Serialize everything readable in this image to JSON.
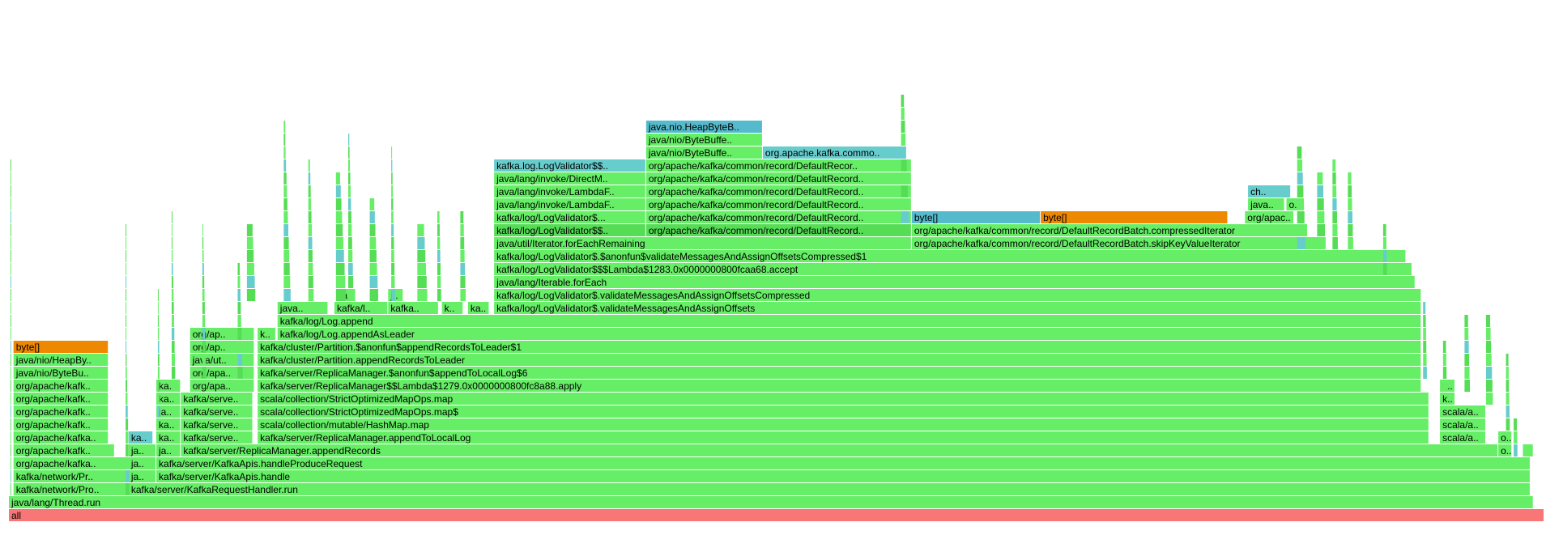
{
  "chart_data": {
    "type": "flamegraph",
    "frame_colors": {
      "root": "#f87676",
      "java": "#66ee66",
      "inlined": "#55dd55",
      "native": "#66cccc",
      "alloc": "#ee8800",
      "alloc_type": "#55bbcc"
    },
    "frames": [
      {
        "label": "all",
        "depth": 0,
        "start": 0,
        "width": 1000,
        "kind": "root"
      },
      {
        "label": "java/lang/Thread.run",
        "depth": 1,
        "start": 0,
        "width": 993,
        "kind": "java"
      },
      {
        "label": "kafka/network/Pro..",
        "depth": 2,
        "start": 3,
        "width": 74,
        "kind": "java"
      },
      {
        "label": "kafka/server/KafkaRequestHandler.run",
        "depth": 2,
        "start": 78,
        "width": 913,
        "kind": "java"
      },
      {
        "label": "kafka/network/Pr..",
        "depth": 3,
        "start": 3,
        "width": 74,
        "kind": "java"
      },
      {
        "label": "ja..",
        "depth": 3,
        "start": 78,
        "width": 18,
        "kind": "java"
      },
      {
        "label": "kafka/server/KafkaApis.handle",
        "depth": 3,
        "start": 96,
        "width": 895,
        "kind": "java"
      },
      {
        "label": "org/apache/kafka..",
        "depth": 4,
        "start": 3,
        "width": 74,
        "kind": "java"
      },
      {
        "label": "ja..",
        "depth": 4,
        "start": 78,
        "width": 18,
        "kind": "java"
      },
      {
        "label": "kafka/server/KafkaApis.handleProduceRequest",
        "depth": 4,
        "start": 96,
        "width": 895,
        "kind": "java"
      },
      {
        "label": "org/apache/kafk..",
        "depth": 5,
        "start": 3,
        "width": 66,
        "kind": "java"
      },
      {
        "label": "ja..",
        "depth": 5,
        "start": 78,
        "width": 18,
        "kind": "java"
      },
      {
        "label": "ja..",
        "depth": 5,
        "start": 96,
        "width": 16,
        "kind": "java"
      },
      {
        "label": "kafka/server/ReplicaManager.appendRecords",
        "depth": 5,
        "start": 112,
        "width": 858,
        "kind": "java"
      },
      {
        "label": "o..",
        "depth": 5,
        "start": 970,
        "width": 9,
        "kind": "java"
      },
      {
        "label": "org/apache/kafka..",
        "depth": 6,
        "start": 3,
        "width": 62,
        "kind": "java"
      },
      {
        "label": "ka..",
        "depth": 6,
        "start": 78,
        "width": 16,
        "kind": "native"
      },
      {
        "label": "ka..",
        "depth": 6,
        "start": 96,
        "width": 16,
        "kind": "java"
      },
      {
        "label": "kafka/serve..",
        "depth": 6,
        "start": 112,
        "width": 47,
        "kind": "java"
      },
      {
        "label": "kafka/server/ReplicaManager.appendToLocalLog",
        "depth": 6,
        "start": 162,
        "width": 763,
        "kind": "java"
      },
      {
        "label": "scala/a..",
        "depth": 6,
        "start": 932,
        "width": 30,
        "kind": "java"
      },
      {
        "label": "o..",
        "depth": 6,
        "start": 970,
        "width": 9,
        "kind": "java"
      },
      {
        "label": "org/apache/kafk..",
        "depth": 7,
        "start": 3,
        "width": 62,
        "kind": "java"
      },
      {
        "label": "ka..",
        "depth": 7,
        "start": 96,
        "width": 16,
        "kind": "java"
      },
      {
        "label": "kafka/serve..",
        "depth": 7,
        "start": 112,
        "width": 47,
        "kind": "java"
      },
      {
        "label": "scala/collection/mutable/HashMap.map",
        "depth": 7,
        "start": 162,
        "width": 763,
        "kind": "java"
      },
      {
        "label": "scala/a..",
        "depth": 7,
        "start": 932,
        "width": 30,
        "kind": "java"
      },
      {
        "label": "org/apache/kafk..",
        "depth": 8,
        "start": 3,
        "width": 62,
        "kind": "java"
      },
      {
        "label": "ja..",
        "depth": 8,
        "start": 96,
        "width": 16,
        "kind": "java"
      },
      {
        "label": "kafka/serve..",
        "depth": 8,
        "start": 112,
        "width": 47,
        "kind": "java"
      },
      {
        "label": "scala/collection/StrictOptimizedMapOps.map$",
        "depth": 8,
        "start": 162,
        "width": 763,
        "kind": "java"
      },
      {
        "label": "scala/a..",
        "depth": 8,
        "start": 932,
        "width": 30,
        "kind": "java"
      },
      {
        "label": "org/apache/kafk..",
        "depth": 9,
        "start": 3,
        "width": 62,
        "kind": "java"
      },
      {
        "label": "ka..",
        "depth": 9,
        "start": 96,
        "width": 16,
        "kind": "java"
      },
      {
        "label": "kafka/serve..",
        "depth": 9,
        "start": 112,
        "width": 47,
        "kind": "java"
      },
      {
        "label": "scala/collection/StrictOptimizedMapOps.map",
        "depth": 9,
        "start": 162,
        "width": 763,
        "kind": "java"
      },
      {
        "label": "k..",
        "depth": 9,
        "start": 932,
        "width": 10,
        "kind": "java"
      },
      {
        "label": "org/apache/kafk..",
        "depth": 10,
        "start": 3,
        "width": 62,
        "kind": "java"
      },
      {
        "label": "ka..",
        "depth": 10,
        "start": 96,
        "width": 16,
        "kind": "java"
      },
      {
        "label": "org/apa..",
        "depth": 10,
        "start": 118,
        "width": 42,
        "kind": "java"
      },
      {
        "label": "kafka/server/ReplicaManager$$Lambda$1279.0x0000000800fc8a88.apply",
        "depth": 10,
        "start": 162,
        "width": 758,
        "kind": "java"
      },
      {
        "label": "k..",
        "depth": 10,
        "start": 932,
        "width": 10,
        "kind": "java"
      },
      {
        "label": "java/nio/ByteBu..",
        "depth": 11,
        "start": 3,
        "width": 62,
        "kind": "java"
      },
      {
        "label": "org/apa..",
        "depth": 11,
        "start": 118,
        "width": 42,
        "kind": "java"
      },
      {
        "label": "kafka/server/ReplicaManager.$anonfun$appendToLocalLog$6",
        "depth": 11,
        "start": 162,
        "width": 758,
        "kind": "java"
      },
      {
        "label": "java/nio/HeapBy..",
        "depth": 12,
        "start": 3,
        "width": 62,
        "kind": "java"
      },
      {
        "label": "java/ut..",
        "depth": 12,
        "start": 118,
        "width": 42,
        "kind": "java"
      },
      {
        "label": "kafka/cluster/Partition.appendRecordsToLeader",
        "depth": 12,
        "start": 162,
        "width": 758,
        "kind": "java"
      },
      {
        "label": "byte[]",
        "depth": 13,
        "start": 3,
        "width": 62,
        "kind": "alloc"
      },
      {
        "label": "org/ap..",
        "depth": 13,
        "start": 118,
        "width": 42,
        "kind": "java"
      },
      {
        "label": "kafka/cluster/Partition.$anonfun$appendRecordsToLeader$1",
        "depth": 13,
        "start": 162,
        "width": 758,
        "kind": "java"
      },
      {
        "label": "org/ap..",
        "depth": 14,
        "start": 118,
        "width": 42,
        "kind": "java"
      },
      {
        "label": "k..",
        "depth": 14,
        "start": 162,
        "width": 12,
        "kind": "java"
      },
      {
        "label": "kafka/log/Log.appendAsLeader",
        "depth": 14,
        "start": 175,
        "width": 745,
        "kind": "java"
      },
      {
        "label": "kafka/log/Log.append",
        "depth": 15,
        "start": 175,
        "width": 745,
        "kind": "java"
      },
      {
        "label": "java..",
        "depth": 16,
        "start": 175,
        "width": 33,
        "kind": "java"
      },
      {
        "label": "kafka/l..",
        "depth": 16,
        "start": 212,
        "width": 35,
        "kind": "java"
      },
      {
        "label": "kafka..",
        "depth": 16,
        "start": 247,
        "width": 33,
        "kind": "java"
      },
      {
        "label": "k..",
        "depth": 16,
        "start": 282,
        "width": 14,
        "kind": "java"
      },
      {
        "label": "ka..",
        "depth": 16,
        "start": 299,
        "width": 14,
        "kind": "java"
      },
      {
        "label": "kafka/log/LogValidator$.validateMessagesAndAssignOffsets",
        "depth": 16,
        "start": 316,
        "width": 604,
        "kind": "java"
      },
      {
        "label": "ja..",
        "depth": 17,
        "start": 214,
        "width": 12,
        "kind": "java"
      },
      {
        "label": "j..",
        "depth": 17,
        "start": 247,
        "width": 10,
        "kind": "java"
      },
      {
        "label": "kafka/log/LogValidator$.validateMessagesAndAssignOffsetsCompressed",
        "depth": 17,
        "start": 316,
        "width": 604,
        "kind": "java"
      },
      {
        "label": "java/lang/Iterable.forEach",
        "depth": 18,
        "start": 316,
        "width": 600,
        "kind": "java"
      },
      {
        "label": "kafka/log/LogValidator$$$Lambda$1283.0x0000000800fcaa68.accept",
        "depth": 19,
        "start": 316,
        "width": 598,
        "kind": "java"
      },
      {
        "label": "kafka/log/LogValidator$.$anonfun$validateMessagesAndAssignOffsetsCompressed$1",
        "depth": 20,
        "start": 316,
        "width": 594,
        "kind": "java"
      },
      {
        "label": "java/util/Iterator.forEachRemaining",
        "depth": 21,
        "start": 316,
        "width": 272,
        "kind": "java"
      },
      {
        "label": "org/apache/kafka/common/record/DefaultRecordBatch.skipKeyValueIterator",
        "depth": 21,
        "start": 588,
        "width": 270,
        "kind": "java"
      },
      {
        "label": "kafka/log/LogValidator$$..",
        "depth": 22,
        "start": 316,
        "width": 99,
        "kind": "inlined"
      },
      {
        "label": "org/apache/kafka/common/record/DefaultRecord..",
        "depth": 22,
        "start": 415,
        "width": 173,
        "kind": "inlined"
      },
      {
        "label": "org/apache/kafka/common/record/DefaultRecordBatch.compressedIterator",
        "depth": 22,
        "start": 588,
        "width": 258,
        "kind": "java"
      },
      {
        "label": "kafka/log/LogValidator$...",
        "depth": 23,
        "start": 316,
        "width": 99,
        "kind": "java"
      },
      {
        "label": "org/apache/kafka/common/record/DefaultRecord..",
        "depth": 23,
        "start": 415,
        "width": 173,
        "kind": "java"
      },
      {
        "label": "byte[]",
        "depth": 23,
        "start": 588,
        "width": 84,
        "kind": "alloc_type"
      },
      {
        "label": "byte[]",
        "depth": 23,
        "start": 672,
        "width": 122,
        "kind": "alloc"
      },
      {
        "label": "org/apac..",
        "depth": 23,
        "start": 805,
        "width": 32,
        "kind": "java"
      },
      {
        "label": "java/lang/invoke/LambdaF..",
        "depth": 24,
        "start": 316,
        "width": 99,
        "kind": "java"
      },
      {
        "label": "org/apache/kafka/common/record/DefaultRecord..",
        "depth": 24,
        "start": 415,
        "width": 173,
        "kind": "java"
      },
      {
        "label": "java..",
        "depth": 24,
        "start": 807,
        "width": 24,
        "kind": "java"
      },
      {
        "label": "o..",
        "depth": 24,
        "start": 832,
        "width": 10,
        "kind": "java"
      },
      {
        "label": "java/lang/invoke/LambdaF..",
        "depth": 25,
        "start": 316,
        "width": 99,
        "kind": "java"
      },
      {
        "label": "org/apache/kafka/common/record/DefaultRecord..",
        "depth": 25,
        "start": 415,
        "width": 173,
        "kind": "java"
      },
      {
        "label": "ch..",
        "depth": 25,
        "start": 807,
        "width": 28,
        "kind": "native"
      },
      {
        "label": "java/lang/invoke/DirectM..",
        "depth": 26,
        "start": 316,
        "width": 99,
        "kind": "java"
      },
      {
        "label": "org/apache/kafka/common/record/DefaultRecord..",
        "depth": 26,
        "start": 415,
        "width": 173,
        "kind": "java"
      },
      {
        "label": "kafka.log.LogValidator$$..",
        "depth": 27,
        "start": 316,
        "width": 99,
        "kind": "native"
      },
      {
        "label": "org/apache/kafka/common/record/DefaultRecor..",
        "depth": 27,
        "start": 415,
        "width": 173,
        "kind": "java"
      },
      {
        "label": "java/nio/ByteBuffe..",
        "depth": 28,
        "start": 415,
        "width": 76,
        "kind": "java"
      },
      {
        "label": "org.apache.kafka.commo..",
        "depth": 28,
        "start": 491,
        "width": 92,
        "kind": "native"
      },
      {
        "label": "java/nio/ByteBuffe..",
        "depth": 29,
        "start": 415,
        "width": 76,
        "kind": "java"
      },
      {
        "label": "java.nio.HeapByteB..",
        "depth": 30,
        "start": 415,
        "width": 76,
        "kind": "alloc_type"
      }
    ],
    "towers": [
      {
        "start": 1,
        "width": 1,
        "depth": 1,
        "height": 27
      },
      {
        "start": 76,
        "width": 3,
        "depth": 2,
        "height": 21
      },
      {
        "start": 97,
        "width": 2,
        "depth": 8,
        "height": 10
      },
      {
        "start": 106,
        "width": 3,
        "depth": 10,
        "height": 14
      },
      {
        "start": 126,
        "width": 3,
        "depth": 11,
        "height": 12
      },
      {
        "start": 149,
        "width": 4,
        "depth": 10,
        "height": 10
      },
      {
        "start": 155,
        "width": 6,
        "depth": 17,
        "height": 6
      },
      {
        "start": 179,
        "width": 5,
        "depth": 17,
        "height": 14
      },
      {
        "start": 195,
        "width": 4,
        "depth": 17,
        "height": 11
      },
      {
        "start": 213,
        "width": 7,
        "depth": 17,
        "height": 10
      },
      {
        "start": 221,
        "width": 4,
        "depth": 17,
        "height": 13
      },
      {
        "start": 235,
        "width": 6,
        "depth": 17,
        "height": 8
      },
      {
        "start": 249,
        "width": 3,
        "depth": 17,
        "height": 12
      },
      {
        "start": 266,
        "width": 7,
        "depth": 17,
        "height": 6
      },
      {
        "start": 279,
        "width": 3,
        "depth": 17,
        "height": 7
      },
      {
        "start": 294,
        "width": 4,
        "depth": 17,
        "height": 7
      },
      {
        "start": 581,
        "width": 6,
        "depth": 22,
        "height": 11
      },
      {
        "start": 839,
        "width": 6,
        "depth": 21,
        "height": 8
      },
      {
        "start": 852,
        "width": 6,
        "depth": 21,
        "height": 6
      },
      {
        "start": 862,
        "width": 4,
        "depth": 21,
        "height": 7
      },
      {
        "start": 872,
        "width": 4,
        "depth": 21,
        "height": 6
      },
      {
        "start": 895,
        "width": 3,
        "depth": 19,
        "height": 4
      },
      {
        "start": 921,
        "width": 3,
        "depth": 11,
        "height": 6
      },
      {
        "start": 934,
        "width": 3,
        "depth": 10,
        "height": 4
      },
      {
        "start": 948,
        "width": 4,
        "depth": 10,
        "height": 6
      },
      {
        "start": 962,
        "width": 5,
        "depth": 9,
        "height": 7
      },
      {
        "start": 975,
        "width": 3,
        "depth": 7,
        "height": 6
      },
      {
        "start": 980,
        "width": 3,
        "depth": 5,
        "height": 3
      },
      {
        "start": 986,
        "width": 7,
        "depth": 5,
        "height": 1
      }
    ]
  }
}
